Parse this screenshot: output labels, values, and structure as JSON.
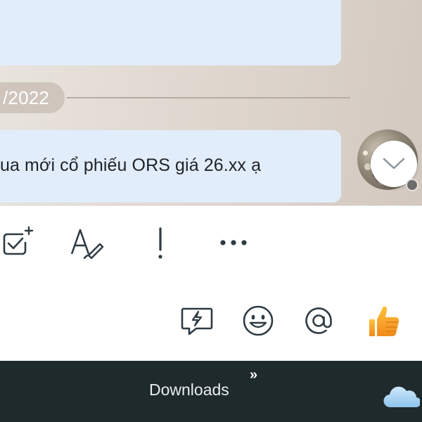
{
  "chat": {
    "date_separator": "/2022",
    "last_message": "ua mới cổ phiếu ORS giá 26.xx ạ"
  },
  "toolbar": {
    "items": [
      {
        "icon": "task-checkbox-icon",
        "label": ""
      },
      {
        "icon": "text-format-icon",
        "label": ""
      },
      {
        "icon": "important-icon",
        "label": ""
      },
      {
        "icon": "more-options-icon",
        "label": ""
      }
    ]
  },
  "input_bar": {
    "items": [
      {
        "icon": "quick-message-icon"
      },
      {
        "icon": "emoji-icon"
      },
      {
        "icon": "mention-icon"
      },
      {
        "icon": "thumbs-up-icon"
      }
    ]
  },
  "taskbar": {
    "downloads_label": "Downloads",
    "overflow_glyph": "»",
    "tray_icon": "onedrive-cloud-icon"
  },
  "colors": {
    "bubble": "#e2edfb",
    "chat_background": "#ddd4cb",
    "icon_stroke": "#2d3b44",
    "thumbs_up": "#f4a62a",
    "taskbar": "#1f2a2c"
  }
}
